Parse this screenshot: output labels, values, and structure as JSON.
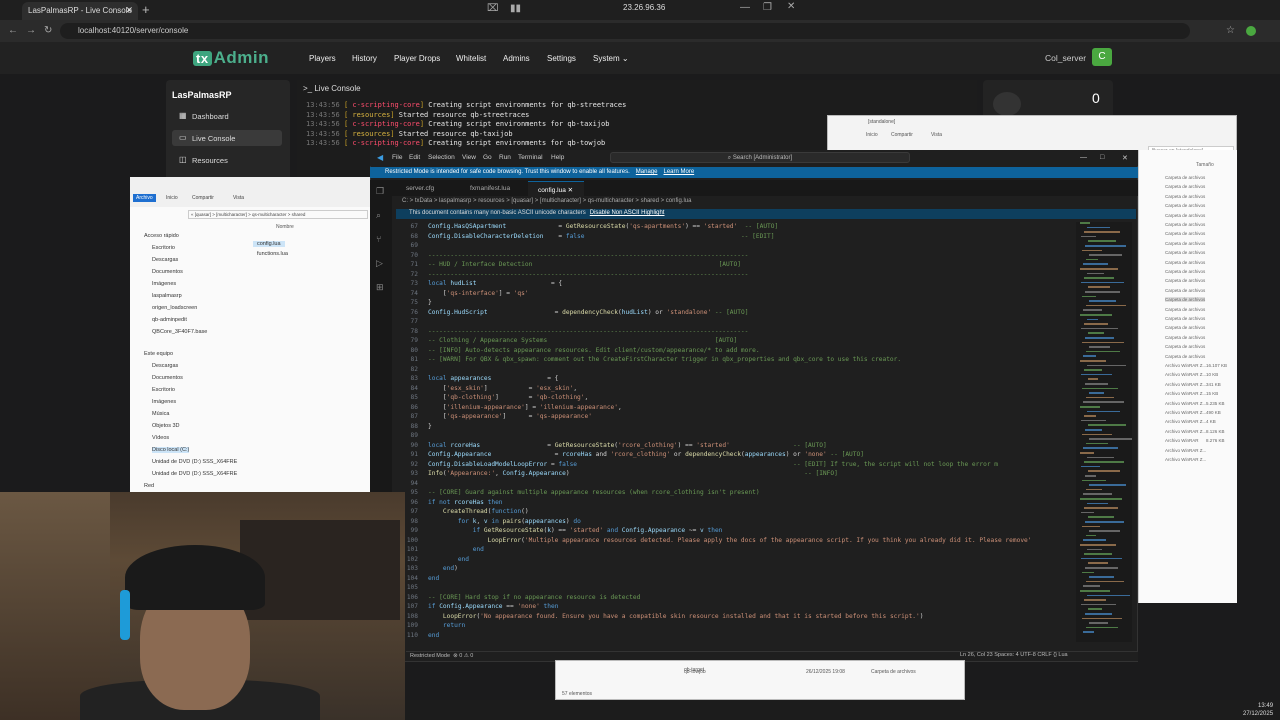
{
  "browser": {
    "tab_title": "LasPalmasRP - Live Console",
    "url": "localhost:40120/server/console",
    "remote_ip": "23.26.96.36"
  },
  "txadmin": {
    "logo_box": "tx",
    "logo_text": "Admin",
    "nav": [
      "Players",
      "History",
      "Player Drops",
      "Whitelist",
      "Admins",
      "Settings",
      "System"
    ],
    "user": "Col_server",
    "user_initial": "C",
    "server_name": "LasPalmasRP",
    "sidebar": [
      {
        "label": "Dashboard",
        "icon": "dashboard-icon"
      },
      {
        "label": "Live Console",
        "icon": "terminal-icon"
      },
      {
        "label": "Resources",
        "icon": "box-icon"
      }
    ],
    "console_title": "Live Console",
    "panel_number": "0",
    "console_lines": [
      {
        "time": "13:43:56",
        "tag": "c-scripting-core",
        "msg": "Creating script environments for qb-streetraces"
      },
      {
        "time": "13:43:56",
        "tag": "resources",
        "msg": "Started resource qb-streetraces"
      },
      {
        "time": "13:43:56",
        "tag": "c-scripting-core",
        "msg": "Creating script environments for qb-taxijob"
      },
      {
        "time": "13:43:56",
        "tag": "resources",
        "msg": "Started resource qb-taxijob"
      },
      {
        "time": "13:43:56",
        "tag": "c-scripting-core",
        "msg": "Creating script environments for qb-towjob"
      }
    ]
  },
  "vscode": {
    "menu": [
      "File",
      "Edit",
      "Selection",
      "View",
      "Go",
      "Run",
      "Terminal",
      "Help"
    ],
    "search": "Search [Administrator]",
    "restricted_msg": "Restricted Mode is intended for safe code browsing. Trust this window to enable all features.",
    "restricted_manage": "Manage",
    "restricted_learn": "Learn More",
    "tabs": [
      "server.cfg",
      "fxmanifest.lua",
      "config.lua"
    ],
    "breadcrumb": "C: > txData > laspalmasrp > resources > [quasar] > [multicharacter] > qs-multicharacter > shared > config.lua",
    "unicode_msg": "This document contains many non-basic ASCII unicode characters",
    "unicode_action": "Disable Non ASCII Highlight",
    "status_left": "Restricted Mode",
    "status_errors": "⊗ 0 ⚠ 0",
    "status_right": "Ln 26, Col 23   Spaces: 4   UTF-8   CRLF   {} Lua",
    "code": [
      {
        "n": "67",
        "t": [
          [
            "vr",
            "Config.HasQSApartment"
          ],
          [
            "pl",
            "              = "
          ],
          [
            "fn",
            "GetResourceState"
          ],
          [
            "pl",
            "("
          ],
          [
            "st",
            "'qs-apartments'"
          ],
          [
            "pl",
            ") == "
          ],
          [
            "st",
            "'started'"
          ],
          [
            "cm",
            "  -- [AUTO]"
          ]
        ]
      },
      {
        "n": "68",
        "t": [
          [
            "vr",
            "Config.DisableCharacterDeletion"
          ],
          [
            "pl",
            "    = "
          ],
          [
            "kw",
            "false"
          ],
          [
            "cm",
            "                                          -- [EDIT]"
          ]
        ]
      },
      {
        "n": "69",
        "t": []
      },
      {
        "n": "70",
        "t": [
          [
            "cm",
            "--------------------------------------------------------------------------------------"
          ]
        ]
      },
      {
        "n": "71",
        "t": [
          [
            "cm",
            "-- HUD / Interface Detection                                                  [AUTO]"
          ]
        ]
      },
      {
        "n": "72",
        "t": [
          [
            "cm",
            "--------------------------------------------------------------------------------------"
          ]
        ]
      },
      {
        "n": "73",
        "t": [
          [
            "kw",
            "local "
          ],
          [
            "vr",
            "hudList"
          ],
          [
            "pl",
            "                    = {"
          ]
        ]
      },
      {
        "n": "74",
        "t": [
          [
            "pl",
            "    ["
          ],
          [
            "st",
            "'qs-interface'"
          ],
          [
            "pl",
            "] = "
          ],
          [
            "st",
            "'qs'"
          ]
        ]
      },
      {
        "n": "75",
        "t": [
          [
            "pl",
            "}"
          ]
        ]
      },
      {
        "n": "76",
        "t": [
          [
            "vr",
            "Config.HudScript"
          ],
          [
            "pl",
            "                  = "
          ],
          [
            "fn",
            "dependencyCheck"
          ],
          [
            "pl",
            "("
          ],
          [
            "vr",
            "hudList"
          ],
          [
            "pl",
            ") or "
          ],
          [
            "st",
            "'standalone'"
          ],
          [
            "cm",
            " -- [AUTO]"
          ]
        ]
      },
      {
        "n": "77",
        "t": []
      },
      {
        "n": "78",
        "t": [
          [
            "cm",
            "--------------------------------------------------------------------------------------"
          ]
        ]
      },
      {
        "n": "79",
        "t": [
          [
            "cm",
            "-- Clothing / Appearance Systems                                             [AUTO]"
          ]
        ]
      },
      {
        "n": "80",
        "t": [
          [
            "cm",
            "-- [INFO] Auto-detects appearance resources. Edit client/custom/appearance/* to add more."
          ]
        ]
      },
      {
        "n": "81",
        "t": [
          [
            "cm",
            "-- [WARN] For QBX & qbx_spawn: comment out the CreateFirstCharacter trigger in qbx_properties and qbx_core to use this creator."
          ]
        ]
      },
      {
        "n": "82",
        "t": []
      },
      {
        "n": "83",
        "t": [
          [
            "kw",
            "local "
          ],
          [
            "vr",
            "appearances"
          ],
          [
            "pl",
            "               = {"
          ]
        ]
      },
      {
        "n": "84",
        "t": [
          [
            "pl",
            "    ["
          ],
          [
            "st",
            "'esx_skin'"
          ],
          [
            "pl",
            "]           = "
          ],
          [
            "st",
            "'esx_skin'"
          ],
          [
            "pl",
            ","
          ]
        ]
      },
      {
        "n": "85",
        "t": [
          [
            "pl",
            "    ["
          ],
          [
            "st",
            "'qb-clothing'"
          ],
          [
            "pl",
            "]        = "
          ],
          [
            "st",
            "'qb-clothing'"
          ],
          [
            "pl",
            ","
          ]
        ]
      },
      {
        "n": "86",
        "t": [
          [
            "pl",
            "    ["
          ],
          [
            "st",
            "'illenium-appearance'"
          ],
          [
            "pl",
            "] = "
          ],
          [
            "st",
            "'illenium-appearance'"
          ],
          [
            "pl",
            ","
          ]
        ]
      },
      {
        "n": "87",
        "t": [
          [
            "pl",
            "    ["
          ],
          [
            "st",
            "'qs-appearance'"
          ],
          [
            "pl",
            "]      = "
          ],
          [
            "st",
            "'qs-appearance'"
          ]
        ]
      },
      {
        "n": "88",
        "t": [
          [
            "pl",
            "}"
          ]
        ]
      },
      {
        "n": "89",
        "t": []
      },
      {
        "n": "90",
        "t": [
          [
            "kw",
            "local "
          ],
          [
            "vr",
            "rcoreHas"
          ],
          [
            "pl",
            "                  = "
          ],
          [
            "fn",
            "GetResourceState"
          ],
          [
            "pl",
            "("
          ],
          [
            "st",
            "'rcore_clothing'"
          ],
          [
            "pl",
            ") == "
          ],
          [
            "st",
            "'started'"
          ],
          [
            "cm",
            "                 -- [AUTO]"
          ]
        ]
      },
      {
        "n": "91",
        "t": [
          [
            "vr",
            "Config.Appearance"
          ],
          [
            "pl",
            "                 = "
          ],
          [
            "vr",
            "rcoreHas"
          ],
          [
            "pl",
            " and "
          ],
          [
            "st",
            "'rcore_clothing'"
          ],
          [
            "pl",
            " or "
          ],
          [
            "fn",
            "dependencyCheck"
          ],
          [
            "pl",
            "("
          ],
          [
            "vr",
            "appearances"
          ],
          [
            "pl",
            ") or "
          ],
          [
            "st",
            "'none'"
          ],
          [
            "cm",
            " -- [AUTO]"
          ]
        ]
      },
      {
        "n": "92",
        "t": [
          [
            "vr",
            "Config.DisableLoadModelLoopError"
          ],
          [
            "pl",
            " = "
          ],
          [
            "kw",
            "false"
          ],
          [
            "cm",
            "                                                          -- [EDIT] If true, the script will not loop the error m"
          ]
        ]
      },
      {
        "n": "93",
        "t": [
          [
            "fn",
            "Info"
          ],
          [
            "pl",
            "("
          ],
          [
            "st",
            "'Appearance:'"
          ],
          [
            "pl",
            ", "
          ],
          [
            "vr",
            "Config.Appearance"
          ],
          [
            "pl",
            ")"
          ],
          [
            "cm",
            "                                                               -- [INFO]"
          ]
        ]
      },
      {
        "n": "94",
        "t": []
      },
      {
        "n": "95",
        "t": [
          [
            "cm",
            "-- [CORE] Guard against multiple appearance resources (when rcore_clothing isn't present)"
          ]
        ]
      },
      {
        "n": "96",
        "t": [
          [
            "kw",
            "if not "
          ],
          [
            "vr",
            "rcoreHas"
          ],
          [
            "kw",
            " then"
          ]
        ]
      },
      {
        "n": "97",
        "t": [
          [
            "pl",
            "    "
          ],
          [
            "fn",
            "CreateThread"
          ],
          [
            "pl",
            "("
          ],
          [
            "kw",
            "function"
          ],
          [
            "pl",
            "()"
          ]
        ]
      },
      {
        "n": "98",
        "t": [
          [
            "pl",
            "        "
          ],
          [
            "kw",
            "for "
          ],
          [
            "vr",
            "k"
          ],
          [
            "pl",
            ", "
          ],
          [
            "vr",
            "v"
          ],
          [
            "kw",
            " in "
          ],
          [
            "fn",
            "pairs"
          ],
          [
            "pl",
            "("
          ],
          [
            "vr",
            "appearances"
          ],
          [
            "pl",
            ") "
          ],
          [
            "kw",
            "do"
          ]
        ]
      },
      {
        "n": "99",
        "t": [
          [
            "pl",
            "            "
          ],
          [
            "kw",
            "if "
          ],
          [
            "fn",
            "GetResourceState"
          ],
          [
            "pl",
            "("
          ],
          [
            "vr",
            "k"
          ],
          [
            "pl",
            ") == "
          ],
          [
            "st",
            "'started'"
          ],
          [
            "kw",
            " and "
          ],
          [
            "vr",
            "Config.Appearance"
          ],
          [
            "pl",
            " ~= "
          ],
          [
            "vr",
            "v"
          ],
          [
            "kw",
            " then"
          ]
        ]
      },
      {
        "n": "100",
        "t": [
          [
            "pl",
            "                "
          ],
          [
            "fn",
            "LoopError"
          ],
          [
            "pl",
            "("
          ],
          [
            "st",
            "'Multiple appearance resources detected. Please apply the docs of the appearance script. If you think you already did it. Please remove'"
          ]
        ]
      },
      {
        "n": "101",
        "t": [
          [
            "pl",
            "            "
          ],
          [
            "kw",
            "end"
          ]
        ]
      },
      {
        "n": "102",
        "t": [
          [
            "pl",
            "        "
          ],
          [
            "kw",
            "end"
          ]
        ]
      },
      {
        "n": "103",
        "t": [
          [
            "pl",
            "    "
          ],
          [
            "kw",
            "end"
          ],
          [
            "pl",
            ")"
          ]
        ]
      },
      {
        "n": "104",
        "t": [
          [
            "kw",
            "end"
          ]
        ]
      },
      {
        "n": "105",
        "t": []
      },
      {
        "n": "106",
        "t": [
          [
            "cm",
            "-- [CORE] Hard stop if no appearance resource is detected"
          ]
        ]
      },
      {
        "n": "107",
        "t": [
          [
            "kw",
            "if "
          ],
          [
            "vr",
            "Config.Appearance"
          ],
          [
            "pl",
            " == "
          ],
          [
            "st",
            "'none'"
          ],
          [
            "kw",
            " then"
          ]
        ]
      },
      {
        "n": "108",
        "t": [
          [
            "pl",
            "    "
          ],
          [
            "fn",
            "LoopError"
          ],
          [
            "pl",
            "("
          ],
          [
            "st",
            "'No appearance found. Ensure you have a compatible skin resource installed and that it is started before this script.'"
          ],
          [
            "pl",
            ")"
          ]
        ]
      },
      {
        "n": "109",
        "t": [
          [
            "pl",
            "    "
          ],
          [
            "kw",
            "return"
          ]
        ]
      },
      {
        "n": "110",
        "t": [
          [
            "kw",
            "end"
          ]
        ]
      }
    ]
  },
  "explorer_left": {
    "path": "« [quasar] > [multicharacter] > qs-multicharacter > shared",
    "ribbon": [
      "Archivo",
      "Inicio",
      "Compartir",
      "Vista"
    ],
    "nav_items": [
      "Acceso rápido",
      "Escritorio",
      "Descargas",
      "Documentos",
      "Imágenes",
      "laspalmasrp",
      "origen_loadscreen",
      "qb-adminpedit",
      "QBCore_3F40F7.base",
      "Este equipo",
      "Descargas",
      "Documentos",
      "Escritorio",
      "Imágenes",
      "Música",
      "Objetos 3D",
      "Vídeos",
      "Disco local (C:)",
      "Unidad de DVD (D:) SSS_X64FRE",
      "Unidad de DVD (D:) SSS_X64FRE",
      "Red"
    ],
    "col_header": "Nombre",
    "files": [
      "config.lua",
      "functions.lua"
    ]
  },
  "explorer_right": {
    "title": "[standalone]",
    "ribbon": [
      "Inicio",
      "Compartir",
      "Vista"
    ],
    "search": "Buscar en [standalone]",
    "col_header": "Tamaño",
    "rows": [
      "Carpeta de archivos",
      "Carpeta de archivos",
      "Carpeta de archivos",
      "Carpeta de archivos",
      "Carpeta de archivos",
      "Carpeta de archivos",
      "Carpeta de archivos",
      "Carpeta de archivos",
      "Carpeta de archivos",
      "Carpeta de archivos",
      "Carpeta de archivos",
      "Carpeta de archivos",
      "Carpeta de archivos",
      "Carpeta de archivos",
      "Carpeta de archivos",
      "Carpeta de archivos",
      "Carpeta de archivos",
      "Carpeta de archivos",
      "Carpeta de archivos",
      "Carpeta de archivos",
      "Archivo WinRAR Z...",
      "Archivo WinRAR Z...",
      "Archivo WinRAR Z...",
      "Archivo WinRAR Z...",
      "Archivo WinRAR Z...",
      "Archivo WinRAR Z...",
      "Archivo WinRAR Z...",
      "Archivo WinRAR Z...",
      "Archivo WinRAR",
      "Archivo WinRAR Z...",
      "Archivo WinRAR Z..."
    ],
    "sizes": [
      "16.107 KB",
      "10 KB",
      "341 KB",
      "15 KB",
      "5.235 KB",
      "490 KB",
      "4 KB",
      "8.126 KB",
      "8.276 KB"
    ]
  },
  "explorer_bottom": {
    "rows": [
      {
        "name": "qb-target",
        "date": "",
        "type": ""
      },
      {
        "name": "qb-towjob",
        "date": "26/12/2025 19:08",
        "type": "Carpeta de archivos"
      }
    ],
    "count": "57 elementos"
  },
  "taskbar": {
    "time": "13:49",
    "date": "27/12/2025"
  },
  "colors": {
    "accent_tx": "#3ea57f",
    "vscode_blue": "#0e639c",
    "avatar_green": "#4aa840"
  }
}
